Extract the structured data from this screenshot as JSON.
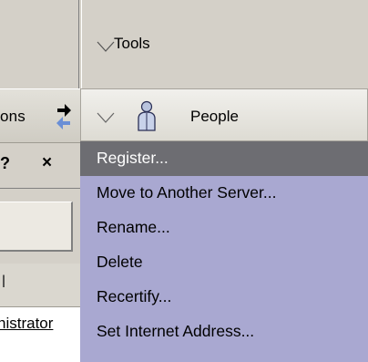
{
  "left_panel": {
    "options_label": "ons",
    "help_glyph": "?",
    "close_glyph": "×",
    "column_header": "l",
    "row_text": "nistrator",
    "icons": [
      "arrow-right-icon",
      "arrow-left-icon"
    ]
  },
  "tools_section": {
    "label": "Tools",
    "icon": "collapse-triangle-icon"
  },
  "people_section": {
    "label": "People",
    "icon": "person-icon"
  },
  "menu": {
    "items": [
      {
        "label": "Register...",
        "selected": true
      },
      {
        "label": "Move to Another Server...",
        "selected": false
      },
      {
        "label": "Rename...",
        "selected": false
      },
      {
        "label": "Delete",
        "selected": false
      },
      {
        "label": "Recertify...",
        "selected": false
      },
      {
        "label": "Set Internet Address...",
        "selected": false
      }
    ]
  },
  "colors": {
    "menu_bg": "#a9a8d1",
    "menu_selected": "#6d6d72",
    "panel_bg": "#d4d0c8"
  }
}
